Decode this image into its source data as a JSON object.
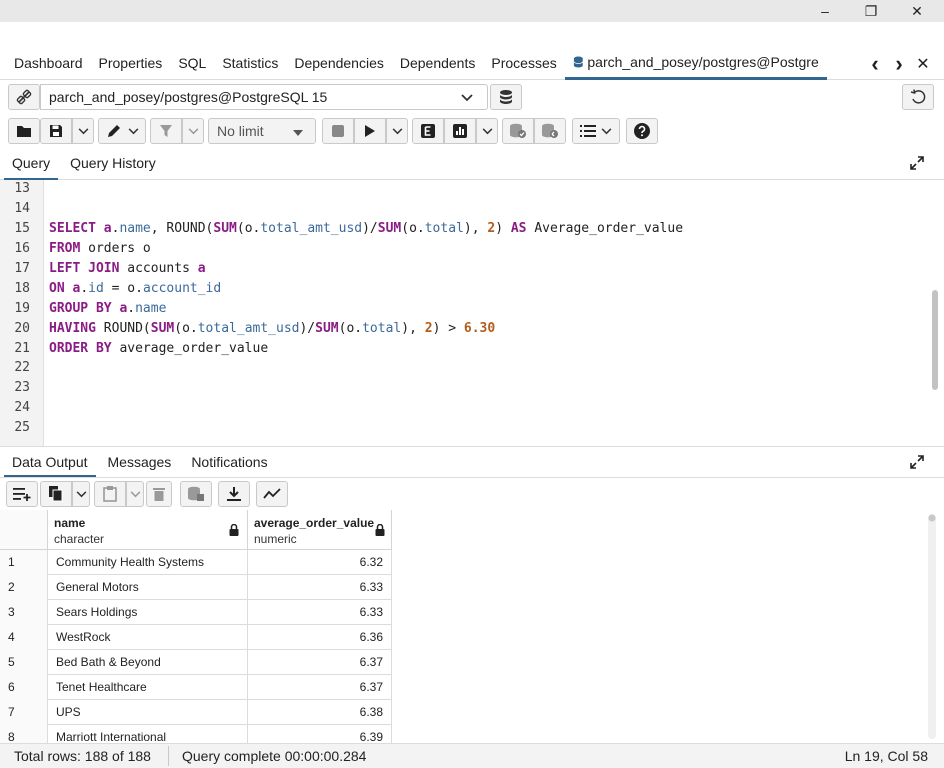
{
  "window": {
    "minimize": "–",
    "restore": "❐",
    "close": "✕"
  },
  "tabs": {
    "items": [
      "Dashboard",
      "Properties",
      "SQL",
      "Statistics",
      "Dependencies",
      "Dependents",
      "Processes"
    ],
    "active": "parch_and_posey/postgres@Postgre",
    "prev": "‹",
    "next": "›",
    "close": "✕"
  },
  "connection": {
    "value": "parch_and_posey/postgres@PostgreSQL 15"
  },
  "toolbar": {
    "limit": "No limit"
  },
  "query_tabs": [
    "Query",
    "Query History"
  ],
  "editor": {
    "line_numbers": [
      "13",
      "14",
      "15",
      "16",
      "17",
      "18",
      "19",
      "20",
      "21",
      "22",
      "23",
      "24",
      "25"
    ]
  },
  "output_tabs": [
    "Data Output",
    "Messages",
    "Notifications"
  ],
  "grid": {
    "columns": [
      {
        "name": "name",
        "type": "character"
      },
      {
        "name": "average_order_value",
        "type": "numeric"
      }
    ],
    "rows": [
      {
        "n": "1",
        "name": "Community Health Systems",
        "value": "6.32"
      },
      {
        "n": "2",
        "name": "General Motors",
        "value": "6.33"
      },
      {
        "n": "3",
        "name": "Sears Holdings",
        "value": "6.33"
      },
      {
        "n": "4",
        "name": "WestRock",
        "value": "6.36"
      },
      {
        "n": "5",
        "name": "Bed Bath & Beyond",
        "value": "6.37"
      },
      {
        "n": "6",
        "name": "Tenet Healthcare",
        "value": "6.37"
      },
      {
        "n": "7",
        "name": "UPS",
        "value": "6.38"
      },
      {
        "n": "8",
        "name": "Marriott International",
        "value": "6.39"
      }
    ]
  },
  "status": {
    "total_rows": "Total rows: 188 of 188",
    "query_complete": "Query complete 00:00:00.284",
    "position": "Ln 19, Col 58"
  },
  "colors": {
    "accent": "#326690",
    "keyword": "#8a1c85",
    "column": "#3b6a9a",
    "number": "#b35c1e"
  }
}
